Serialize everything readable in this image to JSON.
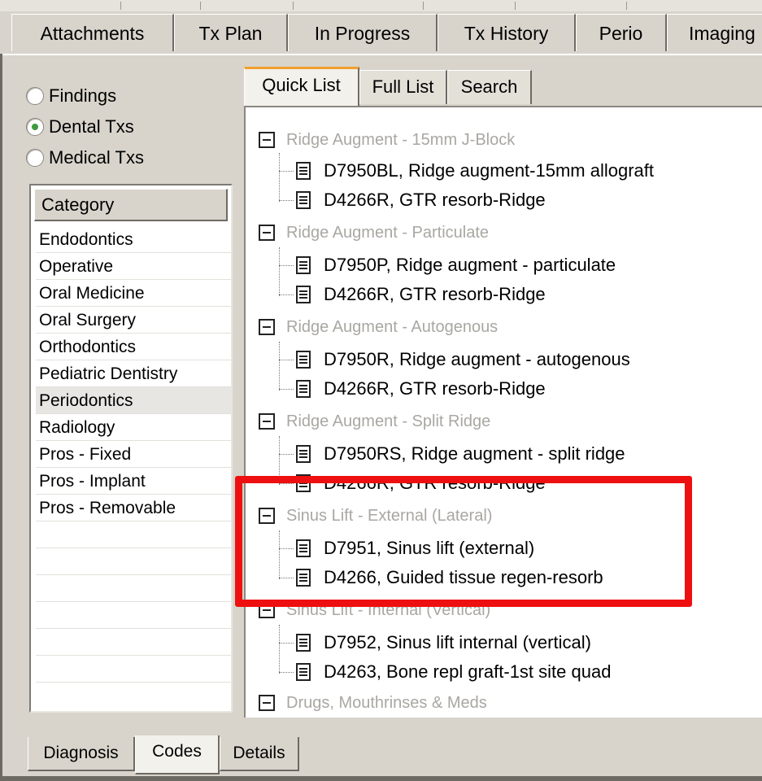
{
  "top_tabs": [
    "Attachments",
    "Tx Plan",
    "In Progress",
    "Tx History",
    "Perio",
    "Imaging"
  ],
  "radio_options": [
    {
      "label": "Findings",
      "selected": false
    },
    {
      "label": "Dental Txs",
      "selected": true
    },
    {
      "label": "Medical Txs",
      "selected": false
    }
  ],
  "category": {
    "header": "Category",
    "items": [
      "Endodontics",
      "Operative",
      "Oral Medicine",
      "Oral Surgery",
      "Orthodontics",
      "Pediatric Dentistry",
      "Periodontics",
      "Radiology",
      "Pros - Fixed",
      "Pros - Implant",
      "Pros - Removable"
    ],
    "selected": "Periodontics"
  },
  "list_tabs": {
    "active": "Quick List",
    "tabs": [
      "Quick List",
      "Full List",
      "Search"
    ]
  },
  "tree": [
    {
      "group": "Ridge Augment - 15mm J-Block",
      "items": [
        "D7950BL, Ridge augment-15mm allograft",
        "D4266R, GTR resorb-Ridge"
      ]
    },
    {
      "group": "Ridge Augment - Particulate",
      "items": [
        "D7950P, Ridge augment - particulate",
        "D4266R, GTR resorb-Ridge"
      ]
    },
    {
      "group": "Ridge Augment - Autogenous",
      "items": [
        "D7950R, Ridge augment - autogenous",
        "D4266R, GTR resorb-Ridge"
      ]
    },
    {
      "group": "Ridge Augment - Split Ridge",
      "items": [
        "D7950RS, Ridge augment - split ridge",
        "D4266R, GTR resorb-Ridge"
      ]
    },
    {
      "group": "Sinus Lift - External (Lateral)",
      "items": [
        "D7951, Sinus lift (external)",
        "D4266, Guided tissue regen-resorb"
      ]
    },
    {
      "group": "Sinus Lift - Internal (Vertical)",
      "items": [
        "D7952, Sinus lift internal (vertical)",
        "D4263, Bone repl graft-1st site quad"
      ]
    },
    {
      "group": "Drugs, Mouthrinses & Meds",
      "items": []
    }
  ],
  "bottom_tabs": {
    "active": "Codes",
    "tabs": [
      "Diagnosis",
      "Codes",
      "Details"
    ]
  },
  "colors": {
    "highlight": "#ee1010",
    "active_tab_accent": "#f0a030",
    "group_text": "#a9a7a2"
  }
}
